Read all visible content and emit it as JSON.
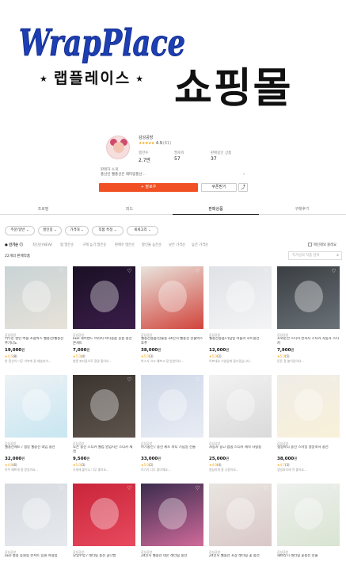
{
  "banner": {
    "logo_text": "WrapPlace",
    "brand_kr": "랩플레이스",
    "star_left": "★",
    "star_right": "★",
    "mall_text": "쇼핑몰"
  },
  "profile": {
    "shop_name": "감성공방",
    "stars": "★★★★★",
    "rating_value": "4.9",
    "rating_count": "(61)",
    "stats": [
      {
        "label": "찜한수",
        "value": "2.7만"
      },
      {
        "label": "팔로워",
        "value": "57"
      },
      {
        "label": "판매중인 상품",
        "value": "37"
      }
    ],
    "intro_label": "판매자 소개",
    "intro_text": "풍선인 웰풍선은 레터링풍선...",
    "intro_chevron": "⌄"
  },
  "buttons": {
    "follow": "+ 팔로우",
    "coupon": "쿠폰받기",
    "share": "⤴"
  },
  "tabs": [
    "프로필",
    "피드",
    "판매상품",
    "구매후기"
  ],
  "active_tab": 2,
  "filters": [
    "주문/일반 ⌄",
    "할인중 ⌄",
    "가격대 ⌄",
    "직품 특정 ⌄",
    "세세고리 ⌄"
  ],
  "sort_options": [
    "● 인기순 ⓘ",
    "최신순(NEW)",
    "찜 많은순",
    "구매 높기 많은순",
    "판매수 많은순",
    "할인율 높은순",
    "낮은 가격순",
    "높은 가격순"
  ],
  "exclude_sold": "매진제외 볼래요",
  "count_text": "22개의 판매작품",
  "search_placeholder": "작가님의 작품 검색",
  "search_icon": "magnifier-icon",
  "heart_icon": "♡",
  "products": [
    {
      "brand": "감성공방",
      "title": "어두운 랜턴 버블 소품박스 웰풍선/웰풍선 주기니노",
      "price": "19,000",
      "rating": "★4.5",
      "rcount": "(8)",
      "review": "한 풍선이 너무 이쁘게 잘 배송되어...",
      "colors": [
        "#c9d3d6",
        "#e7e2d8"
      ]
    },
    {
      "brand": "감성공방",
      "title": "LED 헤어밴드 머리띠 파티용품 응원 풍선 콘서트",
      "price": "7,000",
      "rating": "★5.0",
      "rcount": "(4)",
      "review": "발렌 파티용으로 정말 좋아요...",
      "colors": [
        "#1a1024",
        "#3b1d4a"
      ]
    },
    {
      "brand": "감성공방",
      "title": "웰풍선용품/선물용 24인치 웰풍선 선물박스 호주",
      "price": "38,000",
      "rating": "★5.0",
      "rcount": "(3)",
      "review": "박스가 크고 예쁘고 잘 받았어요...",
      "colors": [
        "#e8e4dc",
        "#d1443c"
      ]
    },
    {
      "brand": "감성공방",
      "title": "웰풍선용품/기념일 러블리 하트풍선",
      "price": "12,000",
      "rating": "★5.0",
      "rcount": "(2)",
      "review": "이쁘네요 기념일에 잘쓰겠습니다...",
      "colors": [
        "#dfe2e6",
        "#f4f4f6"
      ]
    },
    {
      "brand": "감성공방",
      "title": "초보운전 스티커 반사지 스티커 자동차 스티커",
      "price": "7,900",
      "rating": "★5.0",
      "rcount": "(5)",
      "review": "튼튼 잘 붙어있어요...",
      "colors": [
        "#3a3e42",
        "#6a7278"
      ]
    },
    {
      "brand": "감성공방",
      "title": "웰풍선세트 / 생일 웰풍선 네임 풍선",
      "price": "32,000",
      "rating": "★4.8",
      "rcount": "(6)",
      "review": "아주 예쁘게 잘 받았어요...",
      "colors": [
        "#eef2f5",
        "#c8e6f2"
      ]
    },
    {
      "brand": "감성공방",
      "title": "오픈 풍선 스티커 웰컴 영업시간 스티커 제작",
      "price": "9,500",
      "rating": "★5.0",
      "rcount": "(3)",
      "review": "가게에 붙이니 너무 좋아요...",
      "colors": [
        "#3a3430",
        "#5e544c"
      ]
    },
    {
      "brand": "감성공방",
      "title": "아기풍선 / 풍선 세트 파티 기념일 선물",
      "price": "33,000",
      "rating": "★5.0",
      "rcount": "(2)",
      "review": "아기가 너무 좋아해요...",
      "colors": [
        "#cfd8e8",
        "#e8ecf4"
      ]
    },
    {
      "brand": "감성공방",
      "title": "자동차 광고 랩핑 스티커 제작 차량용",
      "price": "25,000",
      "rating": "★4.9",
      "rcount": "(4)",
      "review": "깔끔하게 잘 나왔어요...",
      "colors": [
        "#f2f2f2",
        "#dadada"
      ]
    },
    {
      "brand": "감성공방",
      "title": "생일파티 풍선 스마일 생일축하 풍선",
      "price": "38,000",
      "rating": "★4.7",
      "rcount": "(3)",
      "review": "생일파티에 딱 좋아요...",
      "colors": [
        "#f0ede8",
        "#f8f0d8"
      ]
    },
    {
      "brand": "감성공방",
      "title": "LED 별봉 응원봉 콘서트 응원 야광봉",
      "price": "",
      "rating": "",
      "rcount": "",
      "review": "",
      "colors": [
        "#d7dbe0",
        "#e6e9ee"
      ]
    },
    {
      "brand": "감성공방",
      "title": "당일수령 / 레터링 풍선 꽃다발",
      "price": "",
      "rating": "",
      "rcount": "",
      "review": "",
      "colors": [
        "#c9243a",
        "#e84a5e"
      ]
    },
    {
      "brand": "감성공방",
      "title": "24인치 웰풍선 네온 레터링 풍선",
      "price": "",
      "rating": "",
      "rcount": "",
      "review": "",
      "colors": [
        "#3b2c4e",
        "#d06a9a"
      ]
    },
    {
      "brand": "감성공방",
      "title": "24인치 웰풍선 포장 레터링 꽃 풍선",
      "price": "",
      "rating": "",
      "rcount": "",
      "review": "",
      "colors": [
        "#e9e5e0",
        "#d9c8c8"
      ]
    },
    {
      "brand": "감성공방",
      "title": "해바라기 레터링 꽃풍선 선물",
      "price": "",
      "rating": "",
      "rcount": "",
      "review": "",
      "colors": [
        "#eef0ee",
        "#d9e4d2"
      ]
    }
  ]
}
